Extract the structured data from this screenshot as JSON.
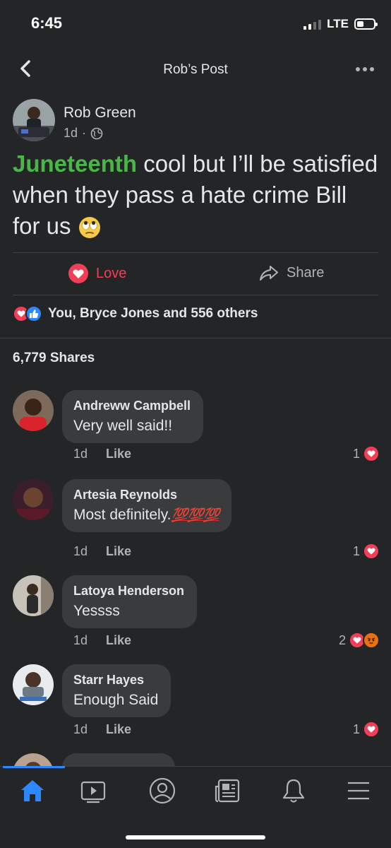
{
  "status_bar": {
    "time": "6:45",
    "network": "LTE"
  },
  "header": {
    "title": "Rob’s Post"
  },
  "post": {
    "author": "Rob Green",
    "time": "1d",
    "privacy_icon": "globe-icon",
    "hashtag": "Juneteenth",
    "text": " cool but I’ll be satisfied when they pass a hate crime Bill for us ",
    "emoji": "face-with-rolling-eyes"
  },
  "actions": {
    "love_label": "Love",
    "share_label": "Share"
  },
  "reactions": {
    "summary": "You, Bryce Jones and 556 others"
  },
  "shares": {
    "label": "6,779 Shares"
  },
  "comments": [
    {
      "name": "Andreww Campbell",
      "text": "Very well said!!",
      "time": "1d",
      "like_label": "Like",
      "reaction_count": "1"
    },
    {
      "name": "Artesia Reynolds",
      "text": "Most definitely.",
      "emoji_text": "💯💯💯",
      "time": "1d",
      "like_label": "Like",
      "reaction_count": "1"
    },
    {
      "name": "Latoya Henderson",
      "text": "Yessss",
      "time": "1d",
      "like_label": "Like",
      "reaction_count": "2"
    },
    {
      "name": "Starr Hayes",
      "text": "Enough Said",
      "time": "1d",
      "like_label": "Like",
      "reaction_count": "1"
    }
  ],
  "colors": {
    "background": "#242526",
    "bubble": "#3a3b3c",
    "love": "#f33e58",
    "hashtag": "#4ab64a",
    "accent": "#2d88ff"
  },
  "tab_bar": {
    "tabs": [
      "home-icon",
      "watch-icon",
      "profile-icon",
      "news-icon",
      "notifications-icon",
      "menu-icon"
    ],
    "active": "home-icon"
  }
}
